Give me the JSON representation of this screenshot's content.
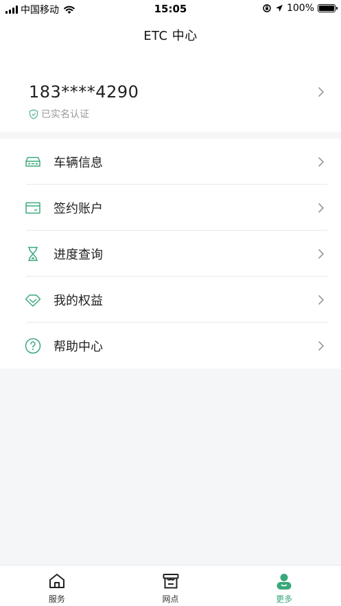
{
  "status_bar": {
    "carrier": "中国移动",
    "time": "15:05",
    "battery": "100%"
  },
  "nav": {
    "title": "ETC 中心"
  },
  "profile": {
    "phone": "183****4290",
    "verification": "已实名认证"
  },
  "menu": {
    "items": [
      {
        "label": "车辆信息",
        "icon": "car-icon"
      },
      {
        "label": "签约账户",
        "icon": "card-icon"
      },
      {
        "label": "进度查询",
        "icon": "hourglass-icon"
      },
      {
        "label": "我的权益",
        "icon": "diamond-icon"
      },
      {
        "label": "帮助中心",
        "icon": "help-icon"
      }
    ]
  },
  "tabs": [
    {
      "label": "服务",
      "icon": "home-icon"
    },
    {
      "label": "网点",
      "icon": "store-icon"
    },
    {
      "label": "更多",
      "icon": "person-icon"
    }
  ],
  "colors": {
    "accent": "#3aa87a",
    "background": "#f5f6f8"
  }
}
